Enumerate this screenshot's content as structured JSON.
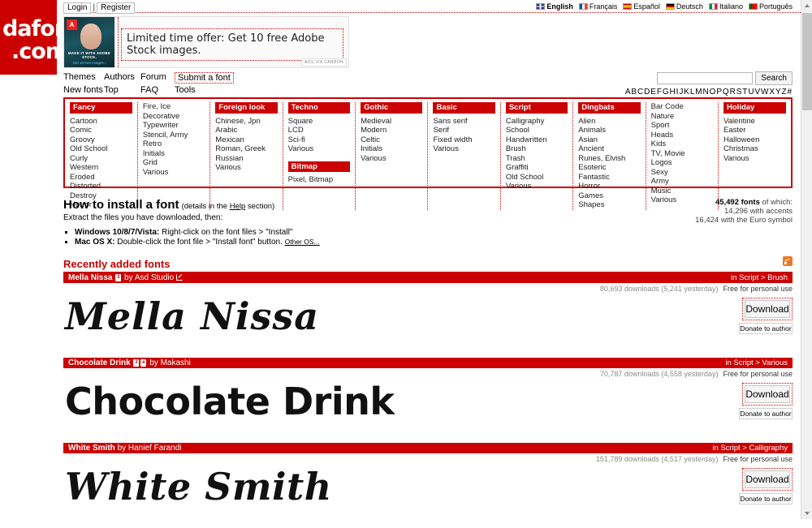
{
  "site": {
    "logo_line1": "dafont",
    "logo_line2": ".com"
  },
  "topbar": {
    "login": "Login",
    "separator": "|",
    "register": "Register",
    "languages": [
      {
        "name": "English",
        "flag": "flag-uk",
        "active": true
      },
      {
        "name": "Français",
        "flag": "flag-fr",
        "active": false
      },
      {
        "name": "Español",
        "flag": "flag-es",
        "active": false
      },
      {
        "name": "Deutsch",
        "flag": "flag-de",
        "active": false
      },
      {
        "name": "Italiano",
        "flag": "flag-it",
        "active": false
      },
      {
        "name": "Português",
        "flag": "flag-pt",
        "active": false
      }
    ]
  },
  "ad": {
    "text": "Limited time offer: Get 10 free Adobe Stock images.",
    "badge": "A",
    "caption1": "MAKE IT WITH ADOBE STOCK.",
    "caption2": "Get 10 free images ›",
    "via": "ADS VIA CARBON"
  },
  "nav": {
    "row1": [
      "Themes",
      "Authors",
      "Forum",
      "Submit a font"
    ],
    "row2": [
      "New fonts",
      "Top",
      "FAQ",
      "Tools"
    ],
    "boxed_item": "Submit a font"
  },
  "search": {
    "value": "",
    "placeholder": "",
    "button": "Search",
    "alphabet": "A B C D E F G H I J K L M N O P Q R S T U V W X Y Z #"
  },
  "categories": [
    {
      "heading": "Fancy",
      "items": [
        "Cartoon",
        "Comic",
        "Groovy",
        "Old School",
        "Curly",
        "Western",
        "Eroded",
        "Distorted",
        "Destroy",
        "Horror"
      ],
      "continued": [
        "Fire, Ice",
        "Decorative",
        "Typewriter",
        "Stencil, Army",
        "Retro",
        "Initials",
        "Grid",
        "Various"
      ]
    },
    {
      "heading": "Foreign look",
      "items": [
        "Chinese, Jpn",
        "Arabic",
        "Mexican",
        "Roman, Greek",
        "Russian",
        "Various"
      ]
    },
    {
      "heading": "Techno",
      "items": [
        "Square",
        "LCD",
        "Sci-fi",
        "Various"
      ],
      "sub_heading": "Bitmap",
      "sub_items": [
        "Pixel, Bitmap"
      ]
    },
    {
      "heading": "Gothic",
      "items": [
        "Medieval",
        "Modern",
        "Celtic",
        "Initials",
        "Various"
      ]
    },
    {
      "heading": "Basic",
      "items": [
        "Sans serif",
        "Serif",
        "Fixed width",
        "Various"
      ]
    },
    {
      "heading": "Script",
      "items": [
        "Calligraphy",
        "School",
        "Handwritten",
        "Brush",
        "Trash",
        "Graffiti",
        "Old School",
        "Various"
      ]
    },
    {
      "heading": "Dingbats",
      "items": [
        "Alien",
        "Animals",
        "Asian",
        "Ancient",
        "Runes, Elvish",
        "Esoteric",
        "Fantastic",
        "Horror",
        "Games",
        "Shapes"
      ],
      "continued": [
        "Bar Code",
        "Nature",
        "Sport",
        "Heads",
        "Kids",
        "TV, Movie",
        "Logos",
        "Sexy",
        "Army",
        "Music",
        "Various"
      ]
    },
    {
      "heading": "Holiday",
      "items": [
        "Valentine",
        "Easter",
        "Halloween",
        "Christmas",
        "Various"
      ]
    }
  ],
  "install": {
    "title": "How to install a font",
    "subtitle_before": "(details in the ",
    "subtitle_link": "Help",
    "subtitle_after": " section)",
    "extract": "Extract the files you have downloaded, then:",
    "steps": [
      {
        "platform": "Windows 10/8/7/Vista:",
        "text": " Right-click on the font files > \"Install\"",
        "link": ""
      },
      {
        "platform": "Mac OS X:",
        "text": " Double-click the font file > \"Install font\" button. ",
        "link": "Other OS..."
      }
    ]
  },
  "stats": {
    "total": "45,492 fonts",
    "total_suffix": " of which:",
    "accents": "14,296 with accents",
    "euro": "16,424 with the Euro symbol"
  },
  "recent": {
    "title": "Recently added fonts",
    "rss_label": "rss-icon"
  },
  "fonts": [
    {
      "name": "Mella Nissa",
      "by": "by Asd Studio",
      "icons": [
        "3"
      ],
      "has_external_link": true,
      "category": "in Script > Brush",
      "downloads": "80,693 downloads (5,241 yesterday)",
      "license": "Free for personal use",
      "download_label": "Download",
      "donate_label": "Donate to author",
      "preview_text": "Mella Nissa",
      "preview_style": "preview-brush"
    },
    {
      "name": "Chocolate Drink",
      "by": "by Makashi",
      "icons": [
        "3",
        "e"
      ],
      "has_external_link": false,
      "category": "in Script > Various",
      "downloads": "70,787 downloads (4,558 yesterday)",
      "license": "Free for personal use",
      "download_label": "Download",
      "donate_label": "Donate to author",
      "preview_text": "Chocolate Drink",
      "preview_style": "preview-bold"
    },
    {
      "name": "White Smith",
      "by": "by Hanief Farandi",
      "icons": [],
      "has_external_link": false,
      "category": "in Script > Calligraphy",
      "downloads": "151,789 downloads (4,517 yesterday)",
      "license": "Free for personal use",
      "download_label": "Download",
      "donate_label": "Donate to author",
      "preview_text": "White Smith",
      "preview_style": "preview-calli"
    }
  ],
  "colors": {
    "brand_red": "#cc0000",
    "rss_orange": "#ee7722"
  }
}
